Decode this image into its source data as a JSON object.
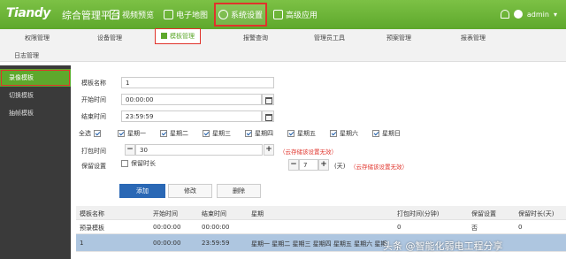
{
  "header": {
    "logo": "Tiandy",
    "app_title": "综合管理平台",
    "nav": [
      {
        "label": "视频预览"
      },
      {
        "label": "电子地图"
      },
      {
        "label": "系统设置"
      },
      {
        "label": "高级应用"
      }
    ],
    "user": "admin"
  },
  "subnav": {
    "items": [
      "权限管理",
      "设备管理",
      "模板管理",
      "报警查询",
      "管理员工具",
      "预案管理",
      "报表管理",
      "日志管理"
    ]
  },
  "sidebar": {
    "items": [
      "录像模板",
      "切换模板",
      "抽帧模板"
    ]
  },
  "form": {
    "name_label": "模板名称",
    "name_value": "1",
    "start_label": "开始时间",
    "start_value": "00:00:00",
    "end_label": "结束时间",
    "end_value": "23:59:59",
    "select_all": "全选",
    "days": [
      "星期一",
      "星期二",
      "星期三",
      "星期四",
      "星期五",
      "星期六",
      "星期日"
    ],
    "pack_label": "打包时间",
    "pack_value": "30",
    "pack_warn": "（云存储该设置无效）",
    "keep_label": "保留设置",
    "keep_checkbox": "保留时长",
    "keep_value": "7",
    "keep_unit": "(天)",
    "keep_warn": "（云存储该设置无效）"
  },
  "buttons": {
    "add": "添加",
    "edit": "修改",
    "delete": "删除"
  },
  "table": {
    "headers": [
      "模板名称",
      "开始时间",
      "结束时间",
      "星期",
      "打包时间(分钟)",
      "保留设置",
      "保留时长(天)"
    ],
    "rows": [
      [
        "预录模板",
        "00:00:00",
        "00:00:00",
        "",
        "0",
        "否",
        "0"
      ],
      [
        "1",
        "00:00:00",
        "23:59:59",
        "星期一 星期二 星期三 星期四 星期五 星期六 星期",
        "",
        "",
        ""
      ]
    ]
  },
  "watermark": "头条 @智能化弱电工程分享",
  "colors": {
    "header_green": "#5ea82c",
    "highlight_red": "#e0332b",
    "primary_blue": "#2a68b5",
    "selected_row": "#aec6e0",
    "sidebar_dark": "#3a3a3a"
  }
}
